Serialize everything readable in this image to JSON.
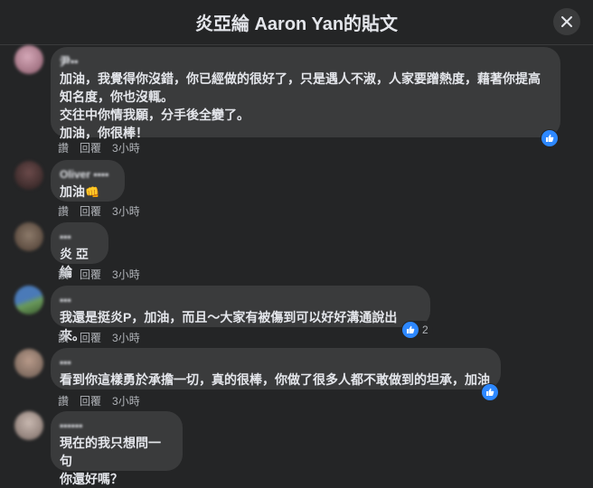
{
  "header": {
    "title": "炎亞綸 Aaron Yan的貼文"
  },
  "actions": {
    "like": "讚",
    "reply": "回覆"
  },
  "comments": [
    {
      "author": "尹▪▪",
      "lines": "加油，我覺得你沒錯，你已經做的很好了，只是遇人不淑，人家要蹭熱度，藉著你提高\n知名度，你也沒輒。\n交往中你情我願，分手後全變了。\n加油，你很棒！",
      "time": "3小時",
      "avatar_colors": [
        "#d5a8b8",
        "#8a5a6a"
      ]
    },
    {
      "author": "Oliver ▪▪▪▪",
      "lines": "加油",
      "emoji": "👊",
      "time": "3小時",
      "avatar_colors": [
        "#6b4a4a",
        "#2a1f1f"
      ]
    },
    {
      "author": "▪▪▪",
      "lines": "炎 亞綸",
      "time": "3小時",
      "avatar_colors": [
        "#8c7a6a",
        "#4a3a30"
      ]
    },
    {
      "author": "▪▪▪",
      "lines": "我還是挺炎P，加油，而且～大家有被傷到可以好好溝通說出來。",
      "time": "3小時",
      "reaction_count": "2",
      "avatar_colors": [
        "#4a7ab8",
        "#6a9a5a"
      ]
    },
    {
      "author": "▪▪▪",
      "lines": "看到你這樣勇於承擔一切，真的很棒，你做了很多人都不敢做到的坦承，加油",
      "time": "3小時",
      "avatar_colors": [
        "#b89a8a",
        "#6a5a50"
      ]
    },
    {
      "author": "▪▪▪▪▪▪",
      "lines": "現在的我只想問一句\n你還好嗎？",
      "avatar_colors": [
        "#c8b8b0",
        "#7a6a64"
      ]
    }
  ],
  "icons": {
    "close": "close-icon",
    "like": "thumbs-up-icon"
  },
  "colors": {
    "background": "#242526",
    "bubble": "#3a3b3c",
    "like_blue": "#2d88ff",
    "text": "#e4e6eb",
    "muted": "#b0b3b8"
  }
}
